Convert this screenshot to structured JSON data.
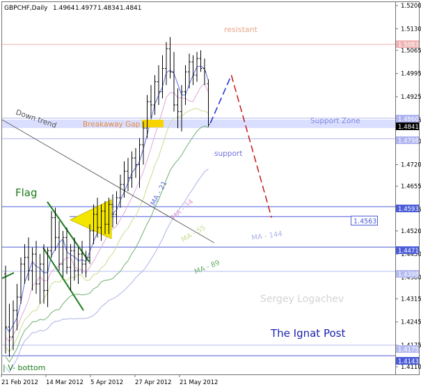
{
  "chart_data": {
    "type": "candlestick",
    "title": "GBPCHF,Daily",
    "ohlc_header": [
      "1.4964",
      "1.4977",
      "1.4834",
      "1.4841"
    ],
    "last_price": "1.4841",
    "ylim": [
      1.4115,
      1.5235
    ],
    "y_ticks": [
      "1.5200",
      "1.5130",
      "1.5065",
      "1.4995",
      "1.4925",
      "1.4855",
      "1.4790",
      "1.4720",
      "1.4655",
      "1.4585",
      "1.4520",
      "1.4450",
      "1.4380",
      "1.4315",
      "1.4245",
      "1.4175",
      "1.4110"
    ],
    "x_ticks": [
      "21 Feb 2012",
      "14 Mar 2012",
      "5 Apr 2012",
      "27 Apr 2012",
      "21 May 2012"
    ],
    "levels": [
      {
        "name": "resistant",
        "value": "1.5083",
        "color": "#f0b4b4"
      },
      {
        "name": "support-zone-top",
        "value": "1.4860",
        "color": "#aeb4f0"
      },
      {
        "name": "support",
        "value": "1.4798",
        "color": "#aeb4f0"
      },
      {
        "name": "flag-level",
        "value": "1.4593",
        "color": "#4a5cd8"
      },
      {
        "name": "level-1.4471",
        "value": "1.4471",
        "color": "#4a5cd8"
      },
      {
        "name": "level-1.4398",
        "value": "1.4398",
        "color": "#b4bbf0"
      },
      {
        "name": "level-1.4175",
        "value": "1.4175",
        "color": "#b4bbf0"
      },
      {
        "name": "v-bottom",
        "value": "1.4143",
        "color": "#4a5cd8"
      }
    ],
    "target_level": "1.4563",
    "moving_averages": [
      {
        "name": "MA - 21",
        "color": "#5f6de0"
      },
      {
        "name": "MA - 34",
        "color": "#e0a8d8"
      },
      {
        "name": "MA - 55",
        "color": "#c8dc90"
      },
      {
        "name": "MA - 89",
        "color": "#6fae6f"
      },
      {
        "name": "MA - 144",
        "color": "#aab2ea"
      }
    ],
    "annotations": {
      "resistant": "resistant",
      "breakaway_gap": "Breakaway Gap",
      "support_zone": "Support Zone",
      "support": "support",
      "down_trend": "Down trend",
      "flag": "Flag",
      "v_bottom": "| V- bottom",
      "author": "Sergey Logachev",
      "publisher": "The Ignat Post"
    },
    "candles": [
      {
        "o": 1.439,
        "h": 1.4415,
        "l": 1.415,
        "c": 1.423
      },
      {
        "o": 1.423,
        "h": 1.43,
        "l": 1.414,
        "c": 1.42
      },
      {
        "o": 1.42,
        "h": 1.431,
        "l": 1.416,
        "c": 1.428
      },
      {
        "o": 1.428,
        "h": 1.436,
        "l": 1.422,
        "c": 1.432
      },
      {
        "o": 1.432,
        "h": 1.444,
        "l": 1.43,
        "c": 1.442
      },
      {
        "o": 1.442,
        "h": 1.448,
        "l": 1.436,
        "c": 1.444
      },
      {
        "o": 1.444,
        "h": 1.45,
        "l": 1.437,
        "c": 1.44
      },
      {
        "o": 1.44,
        "h": 1.447,
        "l": 1.434,
        "c": 1.445
      },
      {
        "o": 1.445,
        "h": 1.449,
        "l": 1.433,
        "c": 1.436
      },
      {
        "o": 1.436,
        "h": 1.445,
        "l": 1.43,
        "c": 1.442
      },
      {
        "o": 1.442,
        "h": 1.448,
        "l": 1.43,
        "c": 1.434
      },
      {
        "o": 1.434,
        "h": 1.447,
        "l": 1.429,
        "c": 1.446
      },
      {
        "o": 1.446,
        "h": 1.458,
        "l": 1.444,
        "c": 1.456
      },
      {
        "o": 1.456,
        "h": 1.459,
        "l": 1.446,
        "c": 1.45
      },
      {
        "o": 1.45,
        "h": 1.455,
        "l": 1.44,
        "c": 1.442
      },
      {
        "o": 1.442,
        "h": 1.452,
        "l": 1.438,
        "c": 1.45
      },
      {
        "o": 1.45,
        "h": 1.453,
        "l": 1.439,
        "c": 1.441
      },
      {
        "o": 1.441,
        "h": 1.448,
        "l": 1.434,
        "c": 1.446
      },
      {
        "o": 1.446,
        "h": 1.45,
        "l": 1.437,
        "c": 1.44
      },
      {
        "o": 1.44,
        "h": 1.447,
        "l": 1.436,
        "c": 1.445
      },
      {
        "o": 1.445,
        "h": 1.449,
        "l": 1.439,
        "c": 1.442
      },
      {
        "o": 1.442,
        "h": 1.446,
        "l": 1.438,
        "c": 1.444
      },
      {
        "o": 1.444,
        "h": 1.454,
        "l": 1.442,
        "c": 1.452
      },
      {
        "o": 1.452,
        "h": 1.46,
        "l": 1.448,
        "c": 1.457
      },
      {
        "o": 1.457,
        "h": 1.462,
        "l": 1.45,
        "c": 1.453
      },
      {
        "o": 1.453,
        "h": 1.46,
        "l": 1.449,
        "c": 1.458
      },
      {
        "o": 1.458,
        "h": 1.461,
        "l": 1.451,
        "c": 1.454
      },
      {
        "o": 1.454,
        "h": 1.462,
        "l": 1.451,
        "c": 1.46
      },
      {
        "o": 1.46,
        "h": 1.463,
        "l": 1.453,
        "c": 1.457
      },
      {
        "o": 1.457,
        "h": 1.464,
        "l": 1.454,
        "c": 1.462
      },
      {
        "o": 1.462,
        "h": 1.469,
        "l": 1.459,
        "c": 1.466
      },
      {
        "o": 1.466,
        "h": 1.473,
        "l": 1.462,
        "c": 1.47
      },
      {
        "o": 1.47,
        "h": 1.474,
        "l": 1.464,
        "c": 1.468
      },
      {
        "o": 1.468,
        "h": 1.476,
        "l": 1.465,
        "c": 1.474
      },
      {
        "o": 1.474,
        "h": 1.477,
        "l": 1.468,
        "c": 1.472
      },
      {
        "o": 1.472,
        "h": 1.48,
        "l": 1.465,
        "c": 1.478
      },
      {
        "o": 1.478,
        "h": 1.485,
        "l": 1.472,
        "c": 1.483
      },
      {
        "o": 1.483,
        "h": 1.493,
        "l": 1.48,
        "c": 1.491
      },
      {
        "o": 1.491,
        "h": 1.496,
        "l": 1.486,
        "c": 1.49
      },
      {
        "o": 1.49,
        "h": 1.499,
        "l": 1.487,
        "c": 1.497
      },
      {
        "o": 1.497,
        "h": 1.502,
        "l": 1.49,
        "c": 1.494
      },
      {
        "o": 1.494,
        "h": 1.505,
        "l": 1.492,
        "c": 1.501
      },
      {
        "o": 1.501,
        "h": 1.509,
        "l": 1.496,
        "c": 1.507
      },
      {
        "o": 1.507,
        "h": 1.5105,
        "l": 1.498,
        "c": 1.5
      },
      {
        "o": 1.5,
        "h": 1.506,
        "l": 1.488,
        "c": 1.49
      },
      {
        "o": 1.49,
        "h": 1.495,
        "l": 1.483,
        "c": 1.488
      },
      {
        "o": 1.488,
        "h": 1.496,
        "l": 1.482,
        "c": 1.494
      },
      {
        "o": 1.494,
        "h": 1.502,
        "l": 1.49,
        "c": 1.5
      },
      {
        "o": 1.5,
        "h": 1.5055,
        "l": 1.495,
        "c": 1.503
      },
      {
        "o": 1.503,
        "h": 1.505,
        "l": 1.496,
        "c": 1.499
      },
      {
        "o": 1.499,
        "h": 1.506,
        "l": 1.497,
        "c": 1.504
      },
      {
        "o": 1.504,
        "h": 1.5065,
        "l": 1.5,
        "c": 1.501
      },
      {
        "o": 1.501,
        "h": 1.504,
        "l": 1.496,
        "c": 1.5
      },
      {
        "o": 1.4964,
        "h": 1.4977,
        "l": 1.4834,
        "c": 1.4841
      }
    ],
    "forecast": [
      {
        "label": "forecast-up",
        "from": {
          "bar": 53.5,
          "value": 1.4845
        },
        "to": {
          "bar": 59,
          "value": 1.499
        },
        "color": "#1a2ad0"
      },
      {
        "label": "forecast-down",
        "from": {
          "bar": 59,
          "value": 1.499
        },
        "to": {
          "bar": 69.5,
          "value": 1.456
        },
        "color": "#c01818"
      }
    ]
  }
}
